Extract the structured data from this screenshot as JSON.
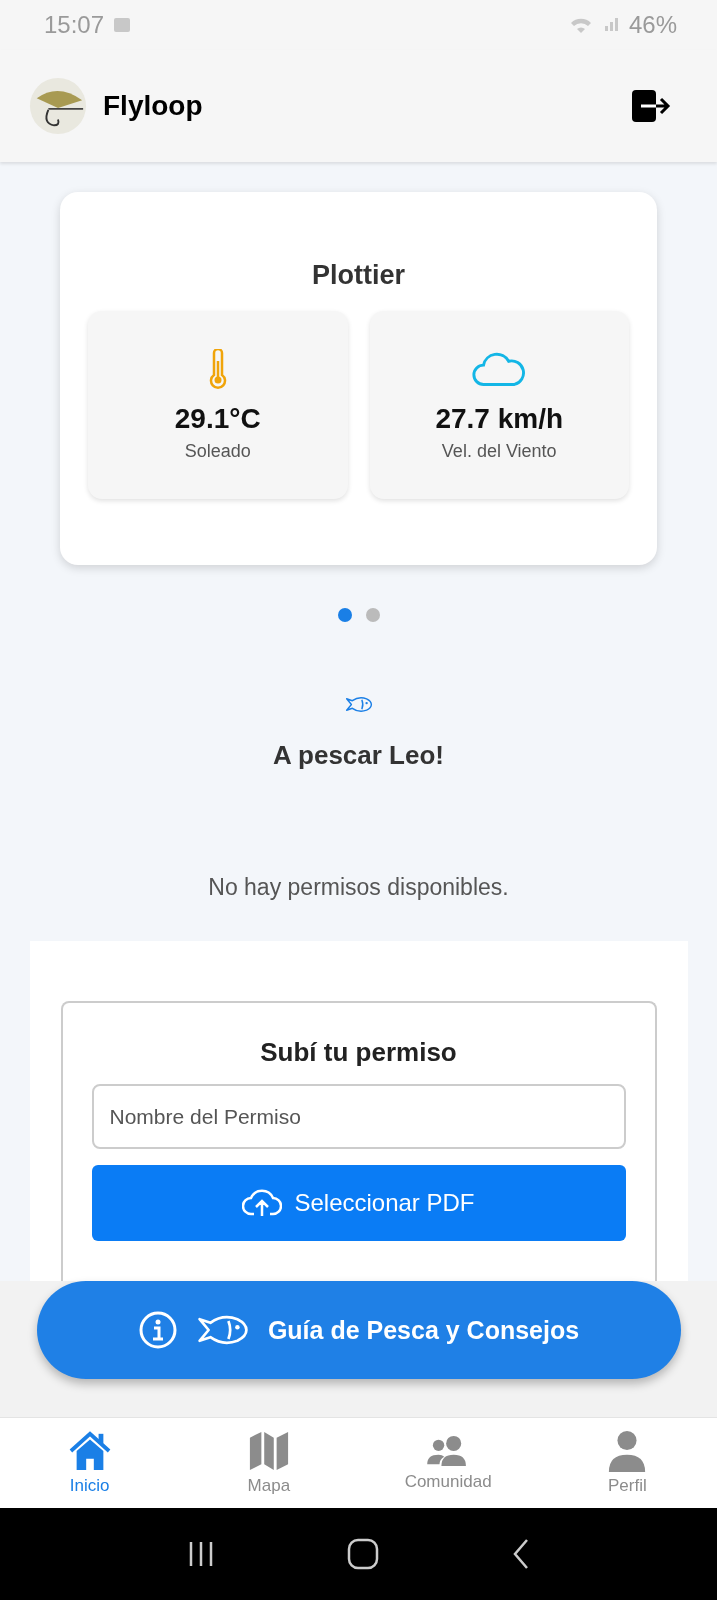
{
  "status_bar": {
    "time": "15:07",
    "battery": "46%"
  },
  "header": {
    "title": "Flyloop"
  },
  "weather": {
    "location": "Plottier",
    "tiles": [
      {
        "kind": "temperature",
        "value": "29.1°C",
        "label": "Soleado"
      },
      {
        "kind": "wind",
        "value": "27.7 km/h",
        "label": "Vel. del Viento"
      }
    ],
    "pages": [
      {
        "selected": true
      },
      {
        "selected": false
      }
    ]
  },
  "greeting": "A pescar Leo!",
  "permits_message": "No hay permisos disponibles.",
  "upload": {
    "title": "Subí tu permiso",
    "name_field": {
      "placeholder": "Nombre del Permiso"
    },
    "button": "Seleccionar PDF"
  },
  "guide_button": "Guía de Pesca y Consejos",
  "nav": [
    {
      "kind": "home",
      "label": "Inicio",
      "selected": true
    },
    {
      "kind": "map",
      "label": "Mapa",
      "selected": false
    },
    {
      "kind": "community",
      "label": "Comunidad",
      "selected": false
    },
    {
      "kind": "profile",
      "label": "Perfil",
      "selected": false
    }
  ]
}
